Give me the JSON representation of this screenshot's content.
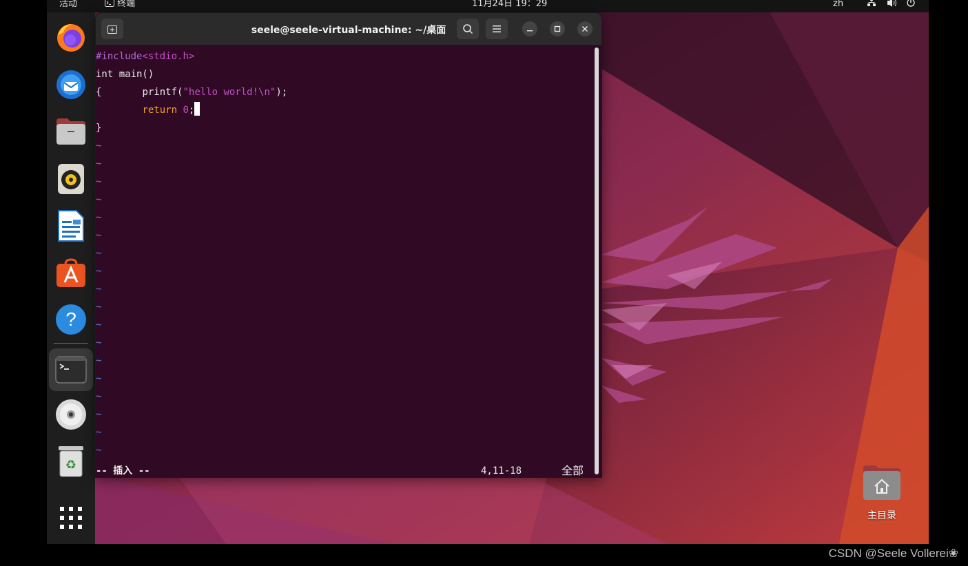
{
  "topbar": {
    "activities": "活动",
    "app_name": "终端",
    "clock": "11月24日 19：29",
    "input_method": "zh"
  },
  "dock": {
    "apps": [
      "firefox-icon",
      "thunderbird-icon",
      "files-icon",
      "rhythmbox-icon",
      "libreoffice-writer-icon",
      "app-center-icon",
      "help-icon",
      "terminal-icon",
      "dvd-icon",
      "trash-icon",
      "show-apps-icon"
    ]
  },
  "terminal": {
    "title": "seele@seele-virtual-machine: ~/桌面",
    "code": {
      "line1_directive": "#include",
      "line1_header": "<stdio.h>",
      "line2": "int main()",
      "line3_brace": "{",
      "line3_func": "printf(",
      "line3_str": "\"hello world!\\n\"",
      "line3_end": ");",
      "line4_kw": "return",
      "line4_num": "0",
      "line4_end": ";",
      "line5": "}"
    },
    "tilde": "~",
    "status_mode": "-- 插入 --",
    "status_pos": "4,11-18",
    "status_scroll": "全部"
  },
  "desktop": {
    "home_label": "主目录"
  },
  "watermark": "CSDN @Seele Vollerei❀",
  "colors": {
    "terminal_bg": "#300a24",
    "accent": "#e95420",
    "tilde": "#5b86d6",
    "keyword": "#f0a030",
    "string": "#c450c8"
  }
}
